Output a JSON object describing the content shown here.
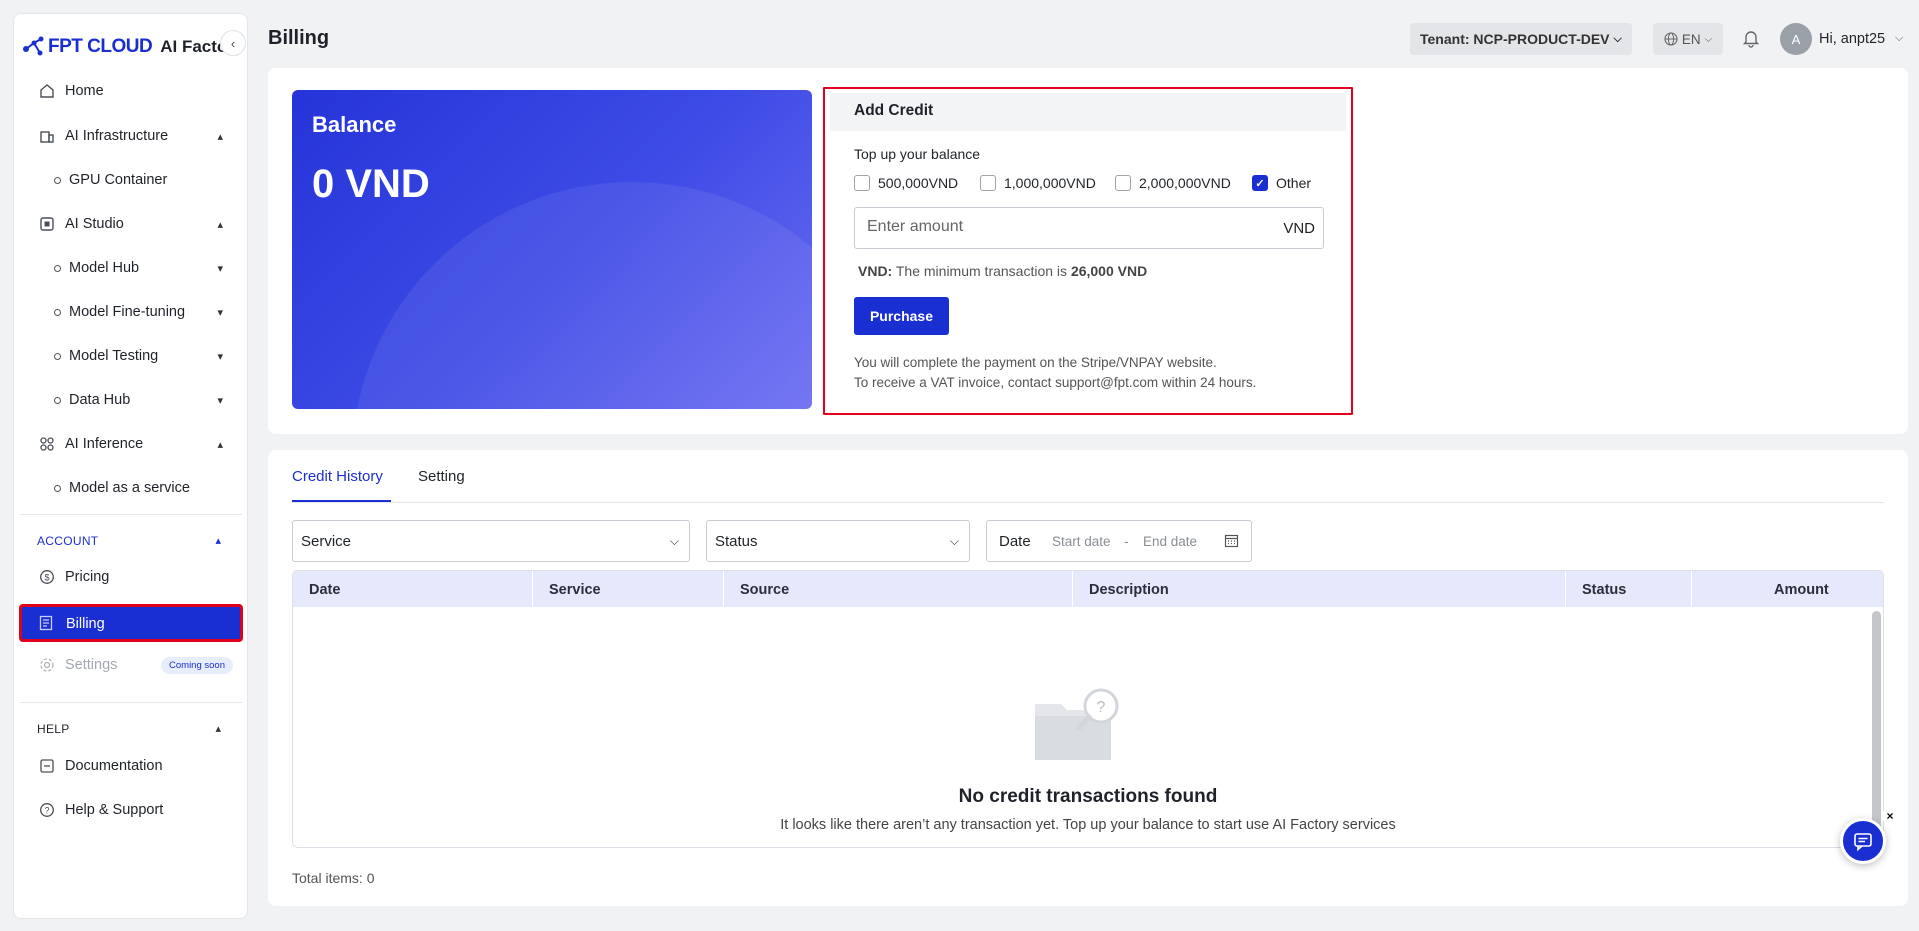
{
  "brand": {
    "logo_text": "FPT CLOUD",
    "product": "AI Factory"
  },
  "sidebar": {
    "home": "Home",
    "ai_infrastructure": "AI Infrastructure",
    "gpu_container": "GPU Container",
    "ai_studio": "AI Studio",
    "model_hub": "Model Hub",
    "model_finetuning": "Model Fine-tuning",
    "model_testing": "Model Testing",
    "data_hub": "Data Hub",
    "ai_inference": "AI Inference",
    "model_as_service": "Model as a service",
    "account_header": "ACCOUNT",
    "pricing": "Pricing",
    "billing": "Billing",
    "settings": "Settings",
    "coming_soon": "Coming soon",
    "help_header": "HELP",
    "documentation": "Documentation",
    "help_support": "Help & Support"
  },
  "header": {
    "title": "Billing",
    "tenant": "Tenant: NCP-PRODUCT-DEV",
    "lang": "EN",
    "avatar": "A",
    "greeting": "Hi, anpt25"
  },
  "balance": {
    "label": "Balance",
    "value": "0 VND"
  },
  "add_credit": {
    "title": "Add Credit",
    "subtitle": "Top up your balance",
    "options": [
      {
        "label": "500,000VND",
        "checked": false
      },
      {
        "label": "1,000,000VND",
        "checked": false
      },
      {
        "label": "2,000,000VND",
        "checked": false
      },
      {
        "label": "Other",
        "checked": true
      }
    ],
    "amount_placeholder": "Enter amount",
    "unit": "VND",
    "min_prefix": "VND:",
    "min_text": "The minimum transaction is",
    "min_value": "26,000 VND",
    "purchase": "Purchase",
    "note1": "You will complete the payment on the Stripe/VNPAY website.",
    "note2": "To receive a VAT invoice, contact support@fpt.com within 24 hours."
  },
  "tabs": {
    "credit_history": "Credit History",
    "setting": "Setting"
  },
  "filters": {
    "service": "Service",
    "status": "Status",
    "date": "Date",
    "start_date": "Start date",
    "dash": "-",
    "end_date": "End date"
  },
  "table": {
    "columns": [
      "Date",
      "Service",
      "Source",
      "Description",
      "Status",
      "Amount"
    ],
    "empty_title": "No credit transactions found",
    "empty_desc": "It looks like there aren’t any transaction yet. Top up your balance to start use AI Factory services"
  },
  "total": "Total items: 0",
  "colors": {
    "accent": "#1a2fd1",
    "highlight": "#e0001b"
  }
}
